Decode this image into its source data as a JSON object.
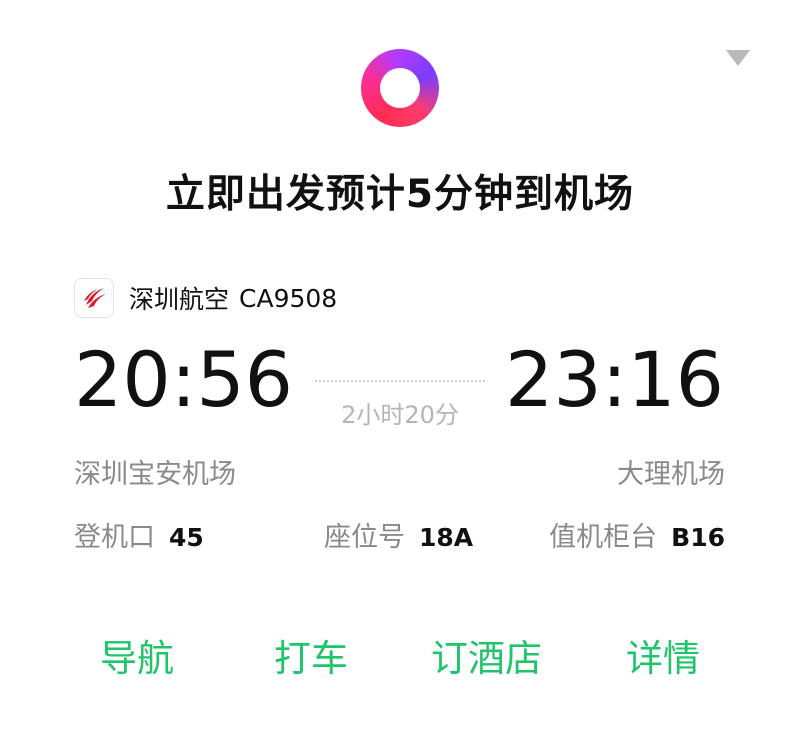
{
  "header": {
    "status_icon": "gradient-ring-icon",
    "collapse_icon": "triangle-down-icon",
    "headline": "立即出发预计5分钟到机场"
  },
  "flight": {
    "airline_logo": "shenzhen-airlines-logo",
    "airline_name": "深圳航空",
    "flight_number": "CA9508",
    "departure_time": "20:56",
    "arrival_time": "23:16",
    "duration": "2小时20分",
    "departure_airport": "深圳宝安机场",
    "arrival_airport": "大理机场"
  },
  "details": {
    "gate_label": "登机口",
    "gate_value": "45",
    "seat_label": "座位号",
    "seat_value": "18A",
    "counter_label": "值机柜台",
    "counter_value": "B16"
  },
  "actions": {
    "navigate": "导航",
    "taxi": "打车",
    "hotel": "订酒店",
    "details": "详情"
  },
  "colors": {
    "action_green": "#20c46b",
    "muted_gray": "#8a8a8a",
    "ring_gradient": [
      "#ff2d55",
      "#b23bff"
    ]
  }
}
